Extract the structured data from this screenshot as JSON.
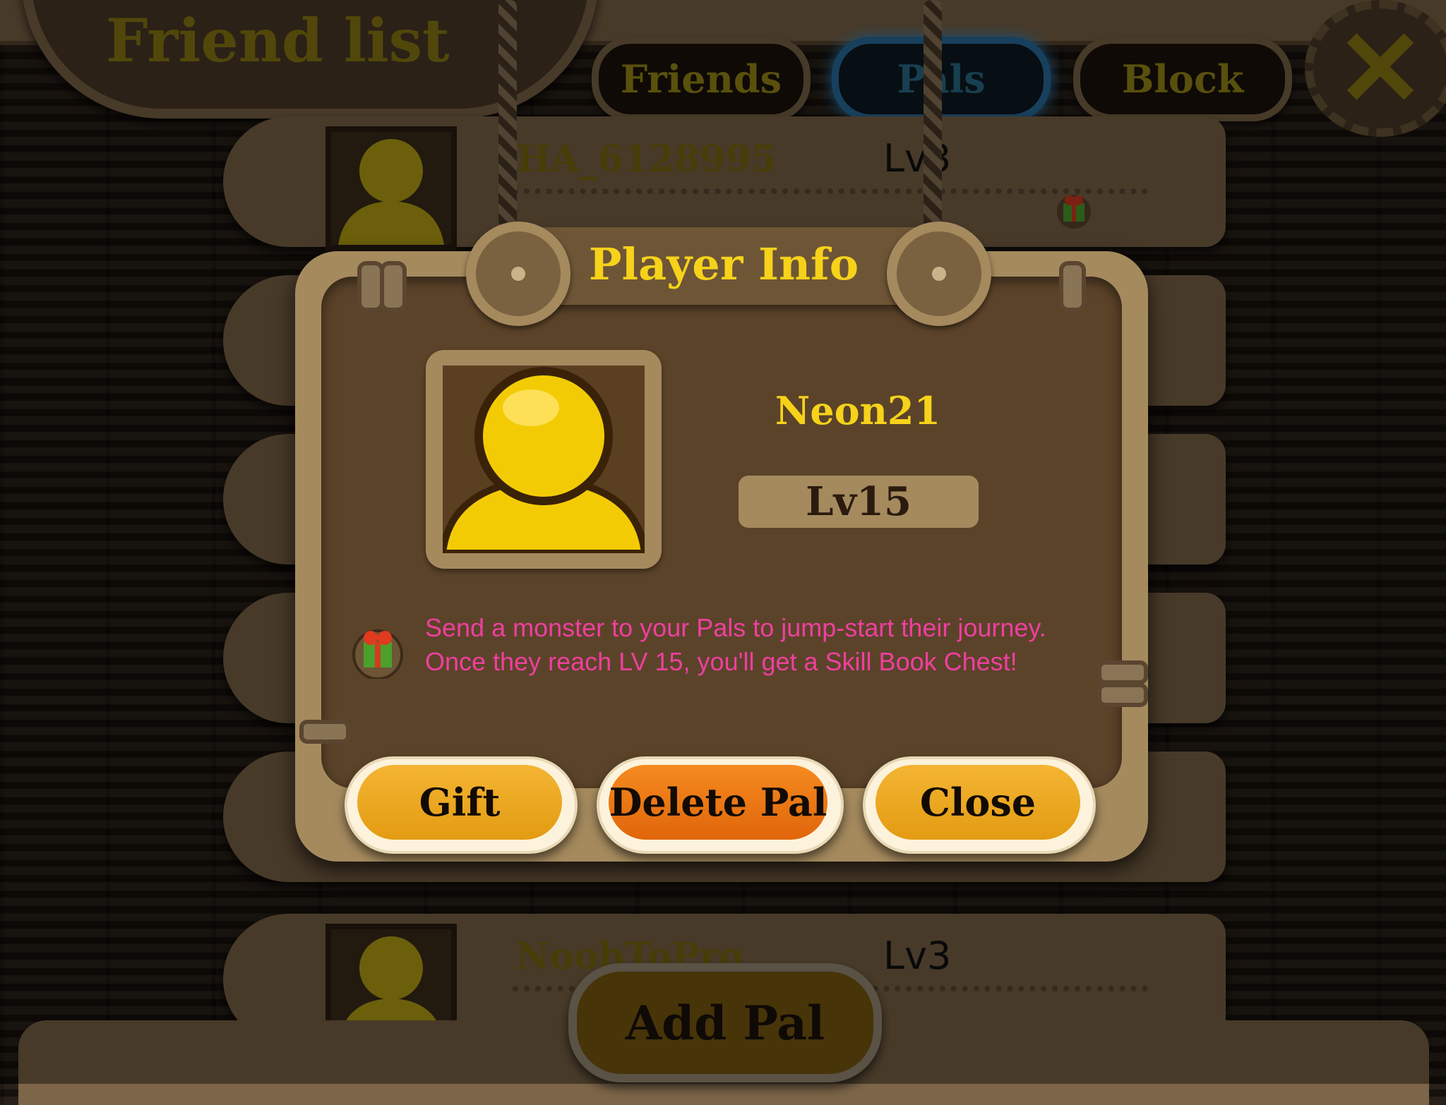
{
  "header": {
    "title": "Friend list",
    "tabs": [
      {
        "label": "Friends",
        "active": false
      },
      {
        "label": "Pals",
        "active": true
      },
      {
        "label": "Block",
        "active": false
      }
    ],
    "close_icon": "x-close-icon"
  },
  "list": {
    "rows": [
      {
        "name": "HA_6128995",
        "level": "Lv3"
      },
      {
        "name": "NoobToPro",
        "level": "Lv3"
      }
    ]
  },
  "add_pal_label": "Add Pal",
  "modal": {
    "title": "Player Info",
    "player_name": "Neon21",
    "player_level": "Lv15",
    "info_text": "Send a monster to your Pals to jump-start their journey. Once they reach LV 15, you'll get a Skill Book Chest!",
    "buttons": {
      "gift": "Gift",
      "delete_pal": "Delete Pal",
      "close": "Close"
    }
  },
  "colors": {
    "title_yellow": "#f6d21a",
    "info_pink": "#ef3f9f",
    "button_gold": "#f0aa22",
    "button_orange": "#ed7516",
    "active_tab_blue": "#2e8ccf"
  }
}
